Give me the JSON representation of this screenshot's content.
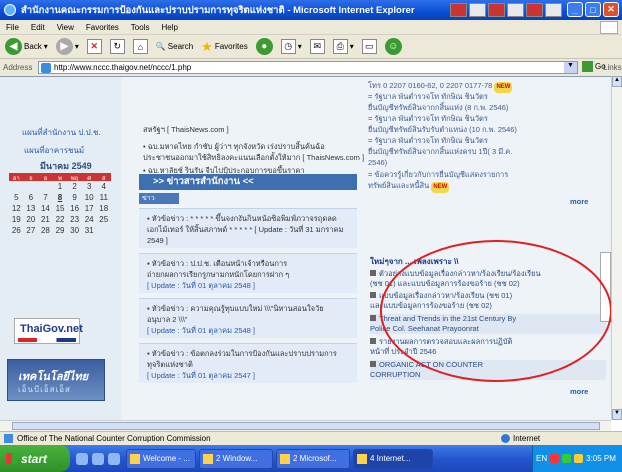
{
  "window": {
    "title": "สำนักงานคณะกรรมการป้องกันและปราบปรามการทุจริตแห่งชาติ - Microsoft Internet Explorer",
    "minimize": "_",
    "maximize": "□",
    "close": "✕"
  },
  "menu": [
    "File",
    "Edit",
    "View",
    "Favorites",
    "Tools",
    "Help"
  ],
  "toolbar": {
    "back": "Back",
    "search": "Search",
    "favorites": "Favorites"
  },
  "address": {
    "label": "Address",
    "url": "http://www.nccc.thaigov.net/nccc/1.php",
    "go": "Go",
    "links": "Links »"
  },
  "left": {
    "link1": "แผนที่สำนักงาน ป.ป.ช.",
    "link2": "แผนที่อาคารชนม์",
    "cal_title": "มีนาคม 2549",
    "cal_headers": [
      "อา",
      "จ",
      "อ",
      "พ",
      "พฤ",
      "ศ",
      "ส"
    ],
    "cal_rows": [
      [
        "",
        "",
        "",
        "1",
        "2",
        "3",
        "4"
      ],
      [
        "5",
        "6",
        "7",
        "8",
        "9",
        "10",
        "11"
      ],
      [
        "12",
        "13",
        "14",
        "15",
        "16",
        "17",
        "18"
      ],
      [
        "19",
        "20",
        "21",
        "22",
        "23",
        "24",
        "25"
      ],
      [
        "26",
        "27",
        "28",
        "29",
        "30",
        "31",
        ""
      ]
    ],
    "thaigov": "ThaiGov.net",
    "banner1": "เทคโนโลยีไทย",
    "banner2": "เอ็นบีเอ็สเอ็ส"
  },
  "mid": {
    "top_src": "สหรัฐฯ  [ ThaisNews.com ]",
    "news1_l1": "•  ฉบ.มหาดไทย กำชับ ผู้ว่าฯ ทุกจังหวัด เร่งปราบสิ้นค้นฉ้อ",
    "news1_l2": "ประชาชนออกมาใช้สิทธิลงคะแนนเลือกตั้งให้มาก  [ ThaisNews.com ]",
    "news2": "•  ฉบ.หาลัยช์ รินรัน จีบไปปุ้ประกอบการขอขึ้นราคา",
    "bar": ">> ข่าวสารสำนักงาน <<",
    "subhdr": "ข่าวประชาสัมพันธ์",
    "items": [
      {
        "l1": "▪  หัวข้อข่าว : * * * * * ขึ้นจงกงันกินหน้อซิอพิมฟ์ภวาจรถุดลด",
        "l2": "เอกไม้เทอร์ ให้สิ้นสภาพด์ * * * * * [ Update : วันที่ 31 มกราคม",
        "l3": "2549 ]"
      },
      {
        "l1": "▪  หัวข้อข่าว : ป.ป.ช. เตือนหน้าเจ้าหรือนการ",
        "l2": "ถ่ายกผลการเรียกรูกษามกหนักโดยการฝาก ๆ",
        "l3": "[ Update : วันที่ 01 ตุลาคม 2548 ]"
      },
      {
        "l1": "▪  หัวข้อข่าว : ความคุณรู้ทุบแบบใหม่ \\\\\\\"นิทานสอนใจวัย",
        "l2": "อนุบาล 2 \\\\\\\"",
        "l3": "[ Update : วันที่ 01 ตุลาคม 2548 ]"
      },
      {
        "l1": "▪  หัวข้อข่าว : ข้อตกลงร่วมในการป้องกันและปราบปรามการ",
        "l2": "ทุจริตแห่งชาติ",
        "l3": "[ Update : วันที่ 01 ตุลาคม 2547 ]"
      }
    ]
  },
  "right": {
    "r1": "โทร 0 2207 0160-62, 0 2207 0177-78",
    "r2": "=  รัฐบาล พันต่ำรวจโท ทักษิณ ชินวัตร",
    "r3": "ยื่นบัญชีทรัพย์สินจากกสิ้นแห่ง (8 ก.พ. 2546)",
    "r4": "=  รัฐบาล พันต่ำรวจโท ทักษิณ ชินวัตร",
    "r5": "ยื่นบัญชีทรัพย์สินรับรับตำแหน่ง (10 ก.พ. 2546)",
    "r6": "=  รัฐบาล พันต่ำรวจโท ทักษิณ ชินวัตร",
    "r7": "ยื่นบัญชีทรัพย์สินจากกสิ้นแห่งครบ 1ปี( 3 มี.ค.",
    "r8": "2546)",
    "r9": "=  ข้อควรรู้เกี่ยวกับการยื่นบัญชีแสดงรายการ",
    "r10": "ทรัพย์สินและหนี้สิน",
    "new": "NEW",
    "more": "more",
    "head": "ใหม่ๆจาก  ...  เพลงเพราะ \\\\",
    "items": [
      "ตัวอย่างแบบข้อมูลเรื่องกล่าวหา/ร้องเรียน/ร้องเรียน",
      "(ชช 01) และแบบข้อมูลการร้องขอร้าย (ชช 02)",
      "แบบข้อมูลเรื่องกล่าวหา/ร้องเรียน (ชช 01)",
      "และแบบข้อมูลการร้องขอร้าย (ชช 02)",
      "Threat and Trends in the 21st Century By",
      "Police Col. Seehanat Prayoonrat",
      "รายงานผลการตรวจสอบและผลการปฏิบัติ",
      "หน้าที่ ประจำปี 2546",
      "ORGANIC ACT ON COUNTER",
      "CORRUPTION"
    ]
  },
  "status": {
    "text": "Office of The National Counter Corruption Commission",
    "zone": "Internet"
  },
  "taskbar": {
    "start": "start",
    "tasks": [
      "Welcome - ...",
      "2 Window...",
      "2 Microsof...",
      "4 Internet..."
    ],
    "time": "3:05 PM",
    "lang": "EN"
  }
}
